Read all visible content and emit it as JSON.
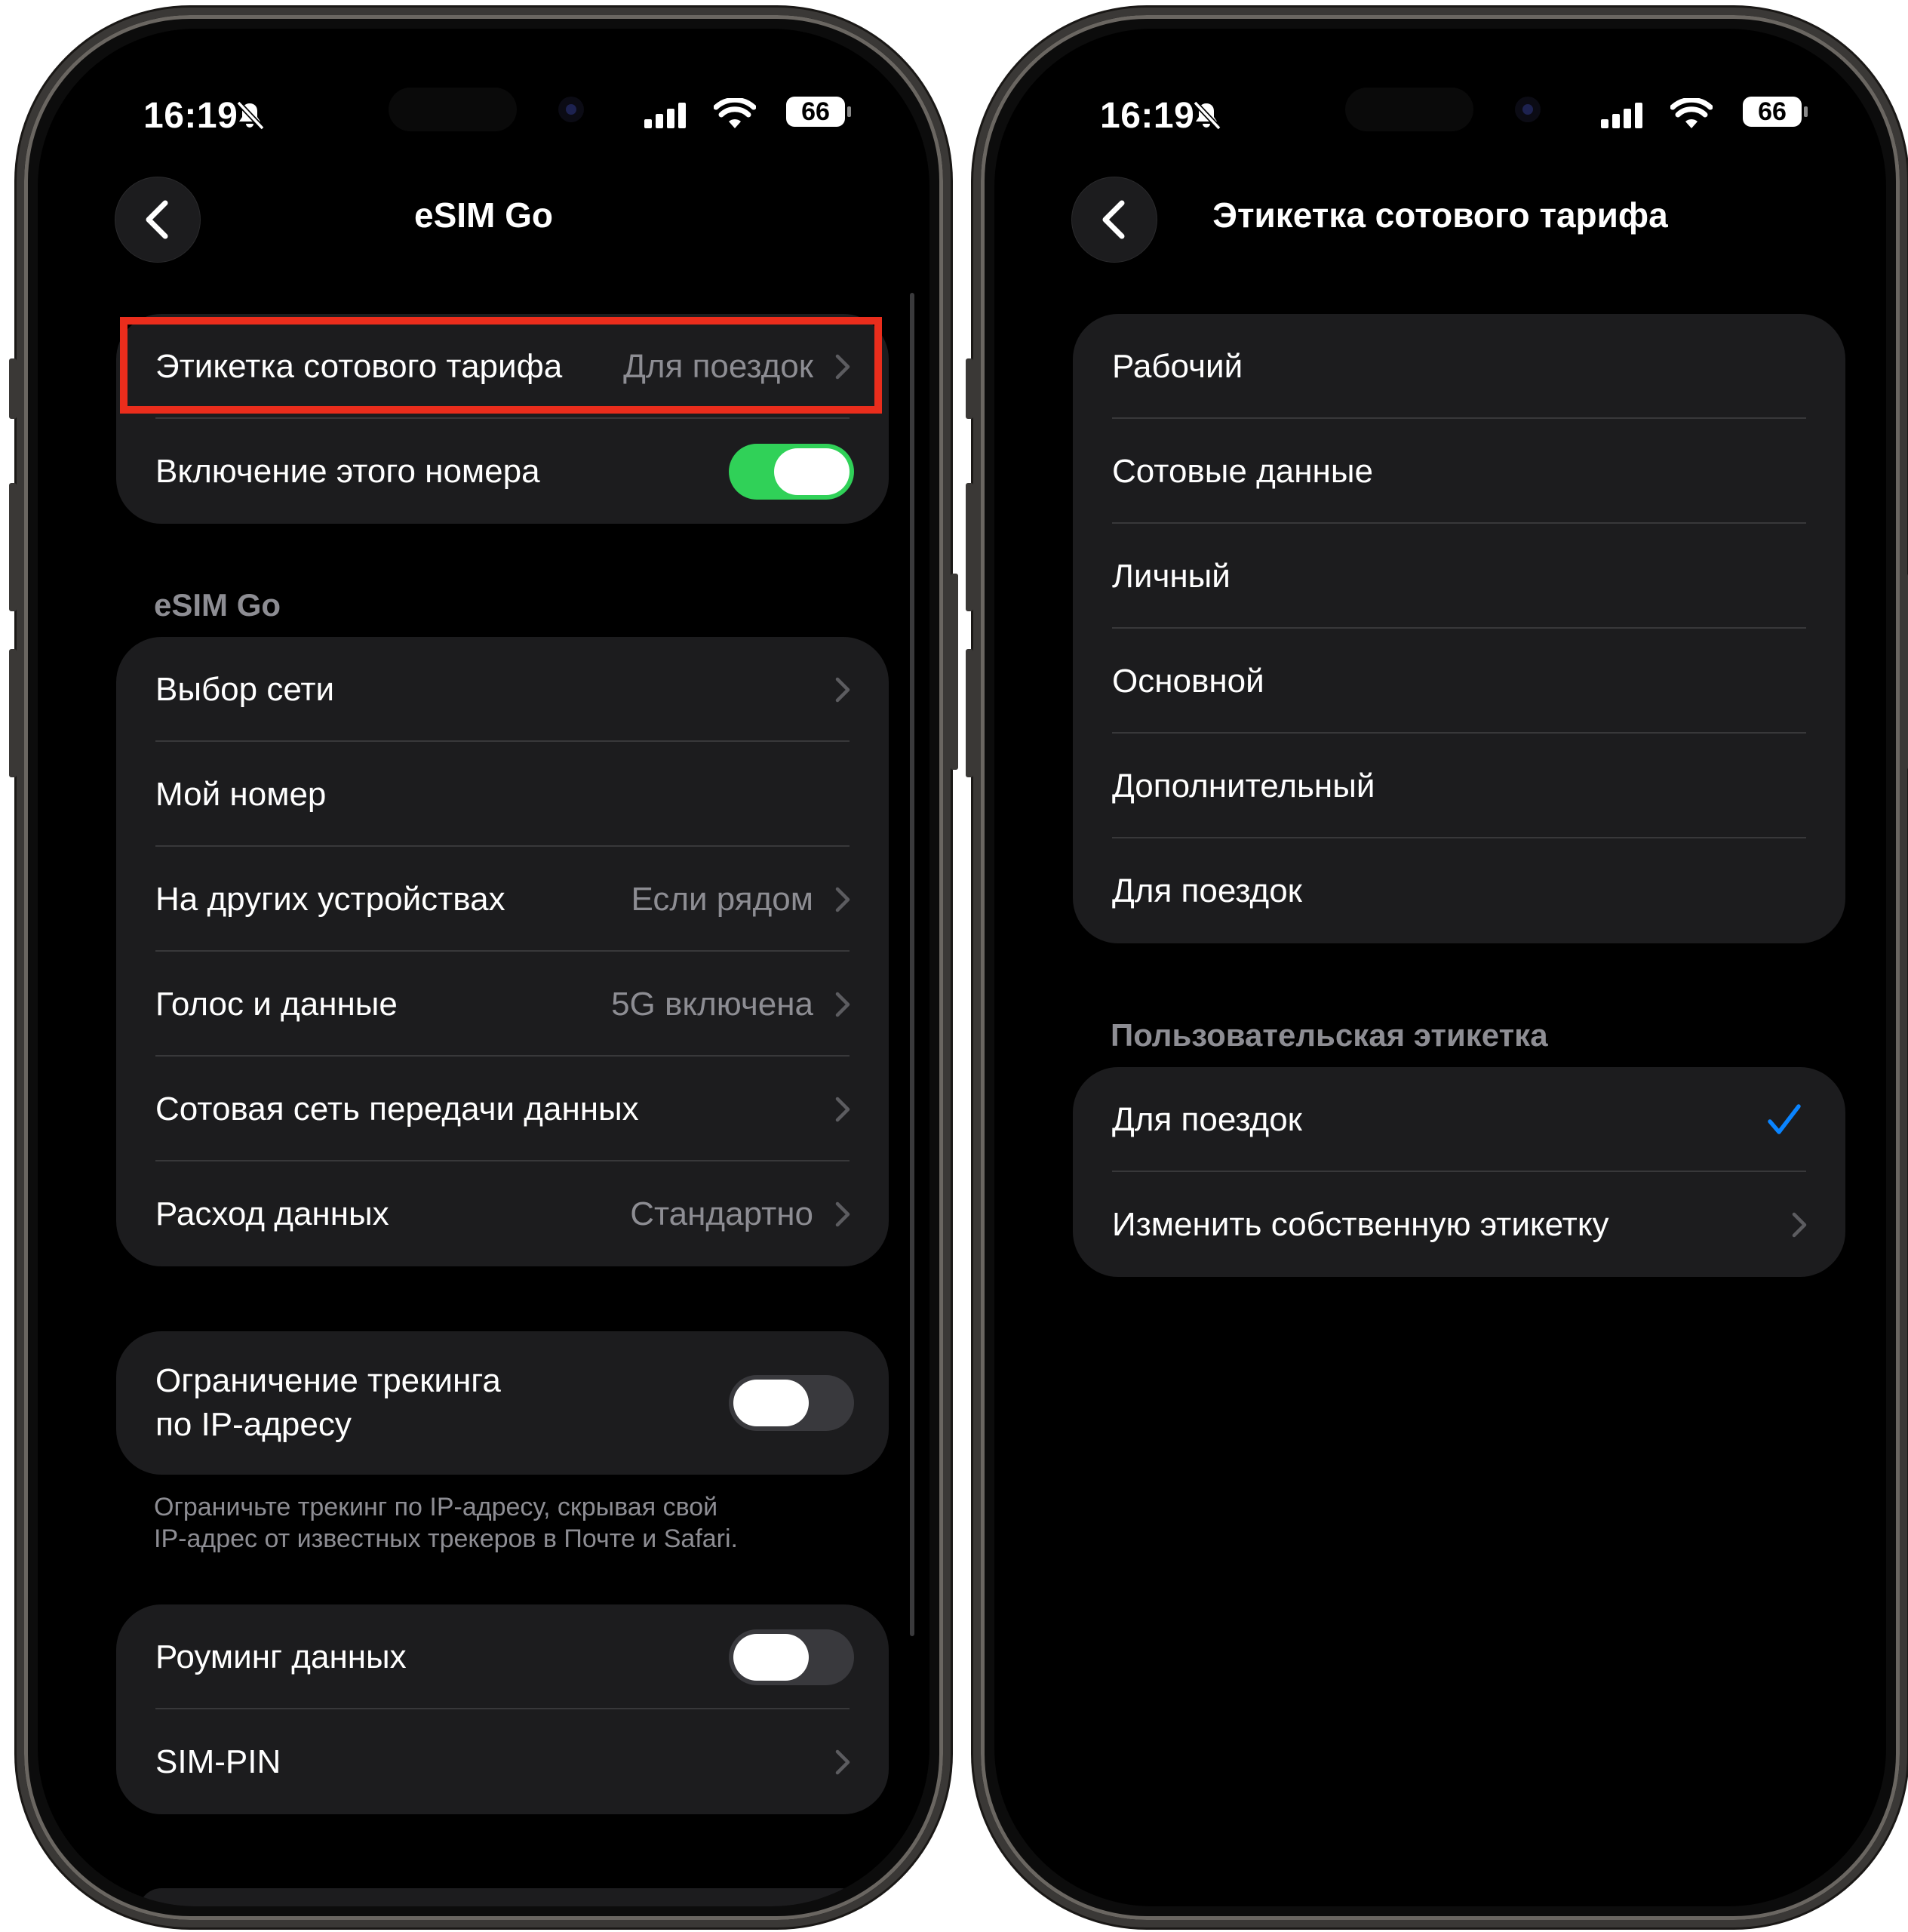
{
  "status_bar": {
    "time": "16:19",
    "battery": "66"
  },
  "left": {
    "nav_title": "eSIM Go",
    "top_group": [
      {
        "label": "Этикетка сотового тарифа",
        "value": "Для поездок"
      },
      {
        "label": "Включение этого номера",
        "toggle": true
      }
    ],
    "section_title": "eSIM Go",
    "esim_rows": [
      {
        "label": "Выбор сети",
        "value": ""
      },
      {
        "label": "Мой номер",
        "value": ""
      },
      {
        "label": "На других устройствах",
        "value": "Если рядом"
      },
      {
        "label": "Голос и данные",
        "value": "5G включена"
      },
      {
        "label": "Сотовая сеть передачи данных",
        "value": ""
      },
      {
        "label": "Расход данных",
        "value": "Стандартно"
      }
    ],
    "ip_tracking": {
      "label_line1": "Ограничение трекинга",
      "label_line2": "по IP-адресу",
      "toggle": false
    },
    "ip_footnote_line1": "Ограничьте трекинг по IP-адресу, скрывая свой",
    "ip_footnote_line2": "IP-адрес от известных трекеров в Почте и Safari.",
    "bottom_group": [
      {
        "label": "Роуминг данных",
        "toggle": false
      },
      {
        "label": "SIM-PIN"
      }
    ]
  },
  "right": {
    "nav_title": "Этикетка сотового тарифа",
    "labels": [
      "Рабочий",
      "Сотовые данные",
      "Личный",
      "Основной",
      "Дополнительный",
      "Для поездок"
    ],
    "custom_section_title": "Пользовательская этикетка",
    "custom_rows": [
      {
        "label": "Для поездок",
        "checked": true
      },
      {
        "label": "Изменить собственную этикетку"
      }
    ]
  },
  "colors": {
    "toggle_on": "#30d158",
    "checkmark": "#0a84ff",
    "highlight_box": "#ea2d1c",
    "cell_bg": "#1c1c1e",
    "secondary_text": "#8d8d93"
  },
  "icons": [
    "back-chevron-icon",
    "bell-slash-icon",
    "cellular-signal-icon",
    "wifi-icon",
    "battery-icon",
    "chevron-right-icon",
    "checkmark-icon"
  ]
}
